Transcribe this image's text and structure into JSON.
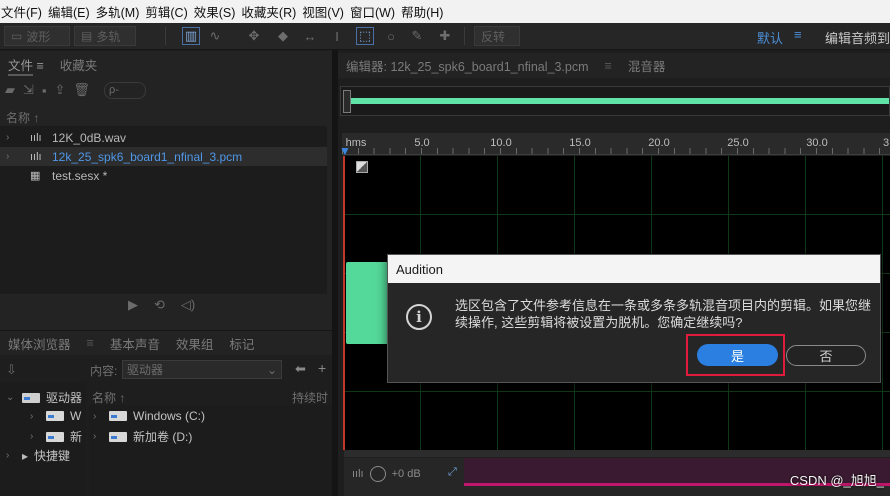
{
  "menu": [
    "文件(F)",
    "编辑(E)",
    "多轨(M)",
    "剪辑(C)",
    "效果(S)",
    "收藏夹(R)",
    "视图(V)",
    "窗口(W)",
    "帮助(H)"
  ],
  "toolbar": {
    "waveform_label": "波形",
    "multitrack_label": "多轨",
    "reverse_label": "反转",
    "workspace_default": "默认",
    "workspace_menu_icon": "≡",
    "workspace_edit": "编辑音频到"
  },
  "files_panel": {
    "tabs": [
      "文件",
      "收藏夹"
    ],
    "search_placeholder": "ρ-",
    "column_name": "名称 ↑",
    "items": [
      {
        "name": "12K_0dB.wav",
        "type": "audio"
      },
      {
        "name": "12k_25_spk6_board1_nfinal_3.pcm",
        "type": "audio",
        "selected": true
      },
      {
        "name": "test.sesx *",
        "type": "session"
      }
    ]
  },
  "media_panel": {
    "tabs": [
      "媒体浏览器",
      "基本声音",
      "效果组",
      "标记"
    ],
    "content_label": "内容:",
    "content_value": "驱动器",
    "column_name": "名称 ↑",
    "column_duration": "持续时",
    "left_tree": [
      "驱动器",
      "W",
      "新",
      "快捷键"
    ],
    "drives": [
      "Windows (C:)",
      "新加卷 (D:)"
    ]
  },
  "editor": {
    "tab_editor": "编辑器: 12k_25_spk6_board1_nfinal_3.pcm",
    "tab_mixer": "混音器",
    "ruler_unit": "hms",
    "ruler_labels": [
      "5.0",
      "10.0",
      "15.0",
      "20.0",
      "25.0",
      "30.0",
      "3"
    ],
    "volume": "+0 dB"
  },
  "dialog": {
    "title": "Audition",
    "message": "选区包含了文件参考信息在一条或多条多轨混音项目内的剪辑。如果您继续操作, 这些剪辑将被设置为脱机。您确定继续吗?",
    "yes_label": "是",
    "no_label": "否"
  },
  "watermark": "CSDN @_旭旭_",
  "colors": {
    "accent_blue": "#2a7fe0",
    "waveform_green": "#5fe3a6",
    "highlight_red": "#e01b3b"
  }
}
